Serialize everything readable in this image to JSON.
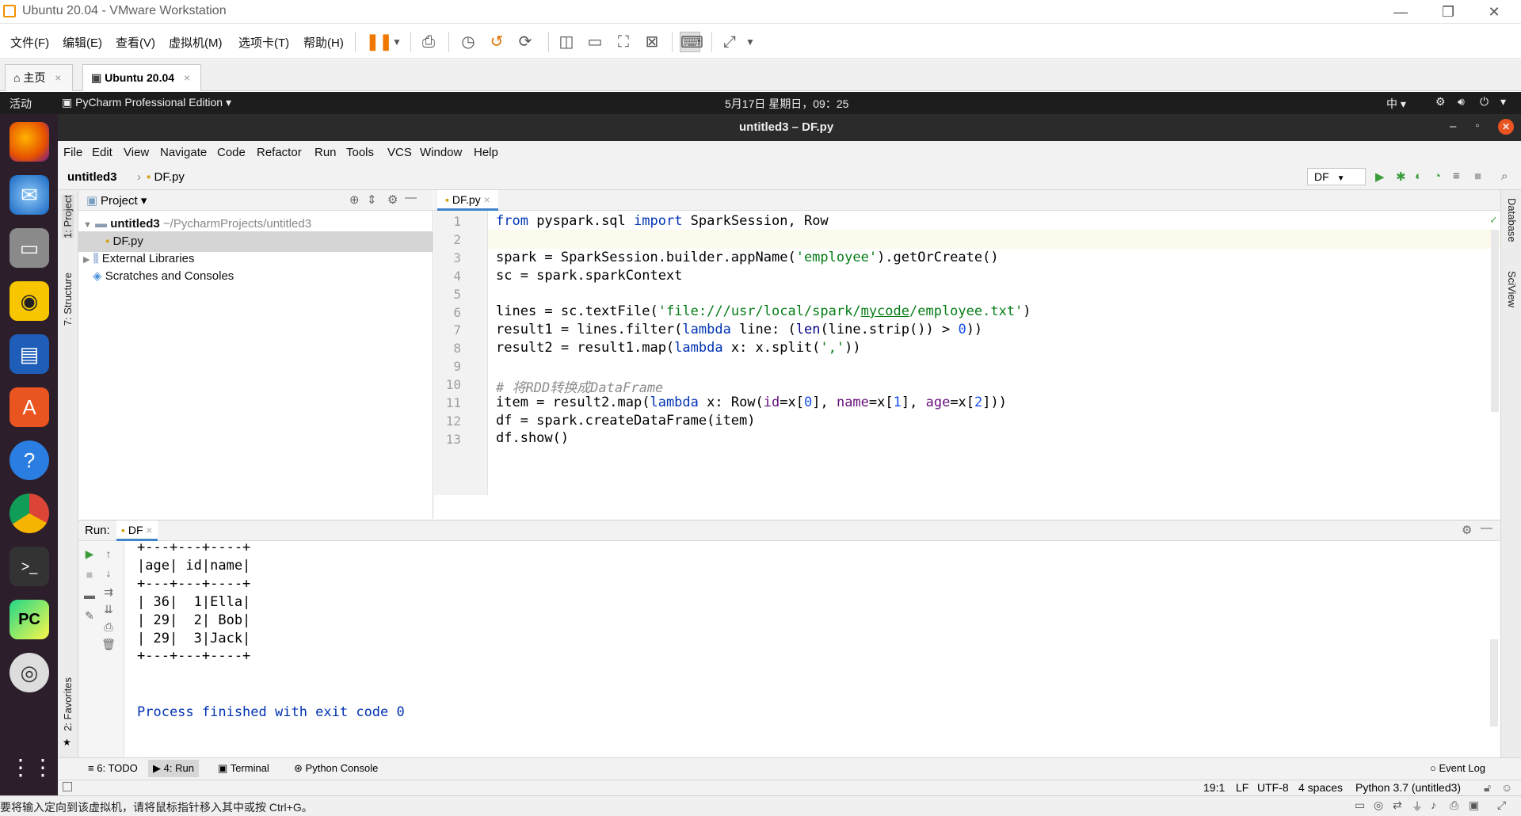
{
  "vmware": {
    "title": "Ubuntu 20.04 - VMware Workstation",
    "menus": [
      "文件(F)",
      "编辑(E)",
      "查看(V)",
      "虚拟机(M)",
      "选项卡(T)",
      "帮助(H)"
    ],
    "tabs": [
      {
        "label": "主页"
      },
      {
        "label": "Ubuntu 20.04"
      }
    ],
    "status_text": "要将输入定向到该虚拟机，请将鼠标指针移入其中或按 Ctrl+G。"
  },
  "ubuntu": {
    "activities": "活动",
    "app_menu": "PyCharm Professional Edition",
    "clock": "5月17日 星期日，09：25",
    "input_method": "中"
  },
  "pycharm": {
    "window_title": "untitled3 – DF.py",
    "menus": [
      "File",
      "Edit",
      "View",
      "Navigate",
      "Code",
      "Refactor",
      "Run",
      "Tools",
      "VCS",
      "Window",
      "Help"
    ],
    "breadcrumb": {
      "project": "untitled3",
      "file": "DF.py"
    },
    "run_config": "DF",
    "left_strip": {
      "project": "1: Project",
      "structure": "7: Structure",
      "favorites": "2: Favorites"
    },
    "right_strip": {
      "database": "Database",
      "sciview": "SciView"
    },
    "project_panel": {
      "title": "Project",
      "root_name": "untitled3",
      "root_path": "~/PycharmProjects/untitled3",
      "file": "DF.py",
      "external": "External Libraries",
      "scratches": "Scratches and Consoles"
    },
    "editor": {
      "tab": "DF.py",
      "line_numbers": [
        "1",
        "2",
        "3",
        "4",
        "5",
        "6",
        "7",
        "8",
        "9",
        "10",
        "11",
        "12",
        "13"
      ]
    },
    "run_panel": {
      "label": "Run:",
      "tab": "DF",
      "output": [
        "+---+---+----+",
        "|age| id|name|",
        "+---+---+----+",
        "| 36|  1|Ella|",
        "| 29|  2| Bob|",
        "| 29|  3|Jack|",
        "+---+---+----+"
      ],
      "finish": "Process finished with exit code 0"
    },
    "tool_windows": {
      "todo": "6: TODO",
      "run": "4: Run",
      "terminal": "Terminal",
      "python_console": "Python Console",
      "event_log": "Event Log"
    },
    "status": {
      "position": "19:1",
      "line_sep": "LF",
      "encoding": "UTF-8",
      "indent": "4 spaces",
      "interpreter": "Python 3.7 (untitled3)"
    }
  }
}
